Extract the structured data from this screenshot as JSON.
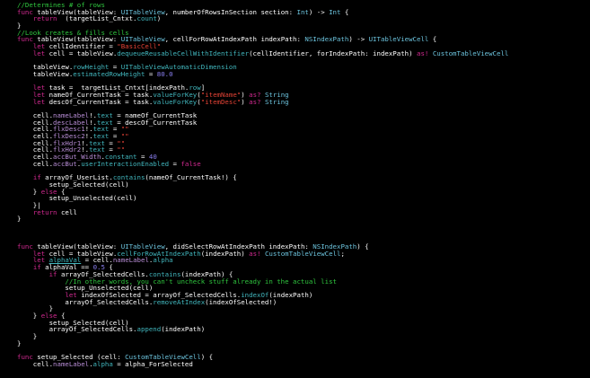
{
  "code": {
    "lines": [
      [
        {
          "t": "//Determines # of rows",
          "c": "cm"
        }
      ],
      [
        {
          "t": "func",
          "c": "kw"
        },
        {
          "t": " tableView(tableView: ",
          "c": "pl"
        },
        {
          "t": "UITableView",
          "c": "ty"
        },
        {
          "t": ", numberOfRowsInSection section: ",
          "c": "pl"
        },
        {
          "t": "Int",
          "c": "ty"
        },
        {
          "t": ") -> ",
          "c": "pl"
        },
        {
          "t": "Int",
          "c": "ty"
        },
        {
          "t": " {",
          "c": "pl"
        }
      ],
      [
        {
          "t": "    ",
          "c": "pl"
        },
        {
          "t": "return",
          "c": "kw"
        },
        {
          "t": "  (targetList_Cntxt.",
          "c": "pl"
        },
        {
          "t": "count",
          "c": "id"
        },
        {
          "t": ")",
          "c": "pl"
        }
      ],
      [
        {
          "t": "}",
          "c": "pl"
        }
      ],
      [
        {
          "t": "//Look creates & fills cells",
          "c": "cm"
        }
      ],
      [
        {
          "t": "func",
          "c": "kw"
        },
        {
          "t": " tableView(tableView: ",
          "c": "pl"
        },
        {
          "t": "UITableView",
          "c": "ty"
        },
        {
          "t": ", cellForRowAtIndexPath indexPath: ",
          "c": "pl"
        },
        {
          "t": "NSIndexPath",
          "c": "ty"
        },
        {
          "t": ") -> ",
          "c": "pl"
        },
        {
          "t": "UITableViewCell",
          "c": "ty"
        },
        {
          "t": " {",
          "c": "pl"
        }
      ],
      [
        {
          "t": "    ",
          "c": "pl"
        },
        {
          "t": "let",
          "c": "kw"
        },
        {
          "t": " cellIdentifier = ",
          "c": "pl"
        },
        {
          "t": "\"BasicCell\"",
          "c": "st"
        }
      ],
      [
        {
          "t": "    ",
          "c": "pl"
        },
        {
          "t": "let",
          "c": "kw"
        },
        {
          "t": " cell = tableView.",
          "c": "pl"
        },
        {
          "t": "dequeueReusableCellWithIdentifier",
          "c": "id"
        },
        {
          "t": "(cellIdentifier, forIndexPath: indexPath) ",
          "c": "pl"
        },
        {
          "t": "as!",
          "c": "kw"
        },
        {
          "t": " ",
          "c": "pl"
        },
        {
          "t": "CustomTableViewCell",
          "c": "ty"
        }
      ],
      [
        {
          "t": "",
          "c": "pl"
        }
      ],
      [
        {
          "t": "    tableView.",
          "c": "pl"
        },
        {
          "t": "rowHeight",
          "c": "id"
        },
        {
          "t": " = ",
          "c": "pl"
        },
        {
          "t": "UITableViewAutomaticDimension",
          "c": "id"
        }
      ],
      [
        {
          "t": "    tableView.",
          "c": "pl"
        },
        {
          "t": "estimatedRowHeight",
          "c": "id"
        },
        {
          "t": " = ",
          "c": "pl"
        },
        {
          "t": "80.0",
          "c": "nu"
        }
      ],
      [
        {
          "t": "",
          "c": "pl"
        }
      ],
      [
        {
          "t": "    ",
          "c": "pl"
        },
        {
          "t": "let",
          "c": "kw"
        },
        {
          "t": " task =  targetList_Cntxt[indexPath.",
          "c": "pl"
        },
        {
          "t": "row",
          "c": "id"
        },
        {
          "t": "]",
          "c": "pl"
        }
      ],
      [
        {
          "t": "    ",
          "c": "pl"
        },
        {
          "t": "let",
          "c": "kw"
        },
        {
          "t": " nameOf_CurrentTask = task.",
          "c": "pl"
        },
        {
          "t": "valueForKey",
          "c": "id"
        },
        {
          "t": "(",
          "c": "pl"
        },
        {
          "t": "\"itemName\"",
          "c": "st"
        },
        {
          "t": ") ",
          "c": "pl"
        },
        {
          "t": "as?",
          "c": "kw"
        },
        {
          "t": " ",
          "c": "pl"
        },
        {
          "t": "String",
          "c": "ty"
        }
      ],
      [
        {
          "t": "    ",
          "c": "pl"
        },
        {
          "t": "let",
          "c": "kw"
        },
        {
          "t": " descOf_CurrentTask = task.",
          "c": "pl"
        },
        {
          "t": "valueForKey",
          "c": "id"
        },
        {
          "t": "(",
          "c": "pl"
        },
        {
          "t": "\"itemDesc\"",
          "c": "st"
        },
        {
          "t": ") ",
          "c": "pl"
        },
        {
          "t": "as?",
          "c": "kw"
        },
        {
          "t": " ",
          "c": "pl"
        },
        {
          "t": "String",
          "c": "ty"
        }
      ],
      [
        {
          "t": "",
          "c": "pl"
        }
      ],
      [
        {
          "t": "    cell.",
          "c": "pl"
        },
        {
          "t": "nameLabel",
          "c": "pm"
        },
        {
          "t": "!.",
          "c": "pl"
        },
        {
          "t": "text",
          "c": "id"
        },
        {
          "t": " = nameOf_CurrentTask",
          "c": "pl"
        }
      ],
      [
        {
          "t": "    cell.",
          "c": "pl"
        },
        {
          "t": "descLabel",
          "c": "pm"
        },
        {
          "t": "!.",
          "c": "pl"
        },
        {
          "t": "text",
          "c": "id"
        },
        {
          "t": " = descOf_CurrentTask",
          "c": "pl"
        }
      ],
      [
        {
          "t": "    cell.",
          "c": "pl"
        },
        {
          "t": "flxDesc1",
          "c": "pm"
        },
        {
          "t": "!.",
          "c": "pl"
        },
        {
          "t": "text",
          "c": "id"
        },
        {
          "t": " = ",
          "c": "pl"
        },
        {
          "t": "\"\"",
          "c": "st"
        }
      ],
      [
        {
          "t": "    cell.",
          "c": "pl"
        },
        {
          "t": "flxDesc2",
          "c": "pm"
        },
        {
          "t": "!.",
          "c": "pl"
        },
        {
          "t": "text",
          "c": "id"
        },
        {
          "t": " = ",
          "c": "pl"
        },
        {
          "t": "\"\"",
          "c": "st"
        }
      ],
      [
        {
          "t": "    cell.",
          "c": "pl"
        },
        {
          "t": "flxHdr1",
          "c": "pm"
        },
        {
          "t": "!.",
          "c": "pl"
        },
        {
          "t": "text",
          "c": "id"
        },
        {
          "t": " = ",
          "c": "pl"
        },
        {
          "t": "\"\"",
          "c": "st"
        }
      ],
      [
        {
          "t": "    cell.",
          "c": "pl"
        },
        {
          "t": "flxHdr2",
          "c": "pm"
        },
        {
          "t": "!.",
          "c": "pl"
        },
        {
          "t": "text",
          "c": "id"
        },
        {
          "t": " = ",
          "c": "pl"
        },
        {
          "t": "\"\"",
          "c": "st"
        }
      ],
      [
        {
          "t": "    cell.",
          "c": "pl"
        },
        {
          "t": "accBut_Width",
          "c": "pm"
        },
        {
          "t": ".",
          "c": "pl"
        },
        {
          "t": "constant",
          "c": "id"
        },
        {
          "t": " = ",
          "c": "pl"
        },
        {
          "t": "40",
          "c": "nu"
        }
      ],
      [
        {
          "t": "    cell.",
          "c": "pl"
        },
        {
          "t": "accBut",
          "c": "pm"
        },
        {
          "t": ".",
          "c": "pl"
        },
        {
          "t": "userInteractionEnabled",
          "c": "id"
        },
        {
          "t": " = ",
          "c": "pl"
        },
        {
          "t": "false",
          "c": "kw"
        }
      ],
      [
        {
          "t": "",
          "c": "pl"
        }
      ],
      [
        {
          "t": "    ",
          "c": "pl"
        },
        {
          "t": "if",
          "c": "kw"
        },
        {
          "t": " arrayOf_UserList.",
          "c": "pl"
        },
        {
          "t": "contains",
          "c": "id"
        },
        {
          "t": "(nameOf_CurrentTask!) {",
          "c": "pl"
        }
      ],
      [
        {
          "t": "        setup_Selected(cell)",
          "c": "pl"
        }
      ],
      [
        {
          "t": "    } ",
          "c": "pl"
        },
        {
          "t": "else",
          "c": "kw"
        },
        {
          "t": " {",
          "c": "pl"
        }
      ],
      [
        {
          "t": "        setup_Unselected(cell)",
          "c": "pl"
        }
      ],
      [
        {
          "t": "    }|",
          "c": "pl"
        }
      ],
      [
        {
          "t": "    ",
          "c": "pl"
        },
        {
          "t": "return",
          "c": "kw"
        },
        {
          "t": " cell",
          "c": "pl"
        }
      ],
      [
        {
          "t": "}",
          "c": "pl"
        }
      ],
      [
        {
          "t": "",
          "c": "pl"
        }
      ],
      [
        {
          "t": "",
          "c": "pl"
        }
      ],
      [
        {
          "t": "",
          "c": "pl"
        }
      ],
      [
        {
          "t": "func",
          "c": "kw"
        },
        {
          "t": " tableView(tableView: ",
          "c": "pl"
        },
        {
          "t": "UITableView",
          "c": "ty"
        },
        {
          "t": ", didSelectRowAtIndexPath indexPath: ",
          "c": "pl"
        },
        {
          "t": "NSIndexPath",
          "c": "ty"
        },
        {
          "t": ") {",
          "c": "pl"
        }
      ],
      [
        {
          "t": "    ",
          "c": "pl"
        },
        {
          "t": "let",
          "c": "kw"
        },
        {
          "t": " cell = tableView.",
          "c": "pl"
        },
        {
          "t": "cellForRowAtIndexPath",
          "c": "id"
        },
        {
          "t": "(indexPath) ",
          "c": "pl"
        },
        {
          "t": "as!",
          "c": "kw"
        },
        {
          "t": " ",
          "c": "pl"
        },
        {
          "t": "CustomTableViewCell",
          "c": "ty"
        },
        {
          "t": ";",
          "c": "pl"
        }
      ],
      [
        {
          "t": "    ",
          "c": "pl"
        },
        {
          "t": "let",
          "c": "kw"
        },
        {
          "t": " ",
          "c": "pl"
        },
        {
          "t": "alphaVal",
          "c": "id",
          "u": true
        },
        {
          "t": " = cell.",
          "c": "pl"
        },
        {
          "t": "nameLabel",
          "c": "pm"
        },
        {
          "t": ".",
          "c": "pl"
        },
        {
          "t": "alpha",
          "c": "id"
        }
      ],
      [
        {
          "t": "    ",
          "c": "pl"
        },
        {
          "t": "if",
          "c": "kw"
        },
        {
          "t": " alphaVal == ",
          "c": "pl"
        },
        {
          "t": "0.5",
          "c": "nu"
        },
        {
          "t": " {",
          "c": "pl"
        }
      ],
      [
        {
          "t": "        ",
          "c": "pl"
        },
        {
          "t": "if",
          "c": "kw"
        },
        {
          "t": " arrayOf_SelectedCells.",
          "c": "pl"
        },
        {
          "t": "contains",
          "c": "id"
        },
        {
          "t": "(indexPath) {",
          "c": "pl"
        }
      ],
      [
        {
          "t": "            ",
          "c": "pl"
        },
        {
          "t": "//In other words, you can't uncheck stuff already in the actual list",
          "c": "cm"
        }
      ],
      [
        {
          "t": "            setup_Unselected(cell)",
          "c": "pl"
        }
      ],
      [
        {
          "t": "            ",
          "c": "pl"
        },
        {
          "t": "let",
          "c": "kw"
        },
        {
          "t": " indexOfSelected = arrayOf_SelectedCells.",
          "c": "pl"
        },
        {
          "t": "indexOf",
          "c": "id"
        },
        {
          "t": "(indexPath)",
          "c": "pl"
        }
      ],
      [
        {
          "t": "            arrayOf_SelectedCells.",
          "c": "pl"
        },
        {
          "t": "removeAtIndex",
          "c": "id"
        },
        {
          "t": "(indexOfSelected!)",
          "c": "pl"
        }
      ],
      [
        {
          "t": "        }",
          "c": "pl"
        }
      ],
      [
        {
          "t": "    } ",
          "c": "pl"
        },
        {
          "t": "else",
          "c": "kw"
        },
        {
          "t": " {",
          "c": "pl"
        }
      ],
      [
        {
          "t": "        setup_Selected(cell)",
          "c": "pl"
        }
      ],
      [
        {
          "t": "        arrayOf_SelectedCells.",
          "c": "pl"
        },
        {
          "t": "append",
          "c": "id"
        },
        {
          "t": "(indexPath)",
          "c": "pl"
        }
      ],
      [
        {
          "t": "    }",
          "c": "pl"
        }
      ],
      [
        {
          "t": "}",
          "c": "pl"
        }
      ],
      [
        {
          "t": "",
          "c": "pl"
        }
      ],
      [
        {
          "t": "func",
          "c": "kw"
        },
        {
          "t": " setup_Selected (cell: ",
          "c": "pl"
        },
        {
          "t": "CustomTableViewCell",
          "c": "ty"
        },
        {
          "t": ") {",
          "c": "pl"
        }
      ],
      [
        {
          "t": "    cell.",
          "c": "pl"
        },
        {
          "t": "nameLabel",
          "c": "pm"
        },
        {
          "t": ".",
          "c": "pl"
        },
        {
          "t": "alpha",
          "c": "id"
        },
        {
          "t": " = alpha_ForSelected",
          "c": "pl"
        }
      ]
    ]
  },
  "theme": {
    "background": "#000000",
    "plain": "#ffffff",
    "keyword": "#d0298f",
    "type": "#6cc3dd",
    "comment": "#2fc43e",
    "string": "#e34235",
    "number": "#8a7ff0",
    "identifier": "#41b6bd",
    "property": "#b88dd6"
  }
}
